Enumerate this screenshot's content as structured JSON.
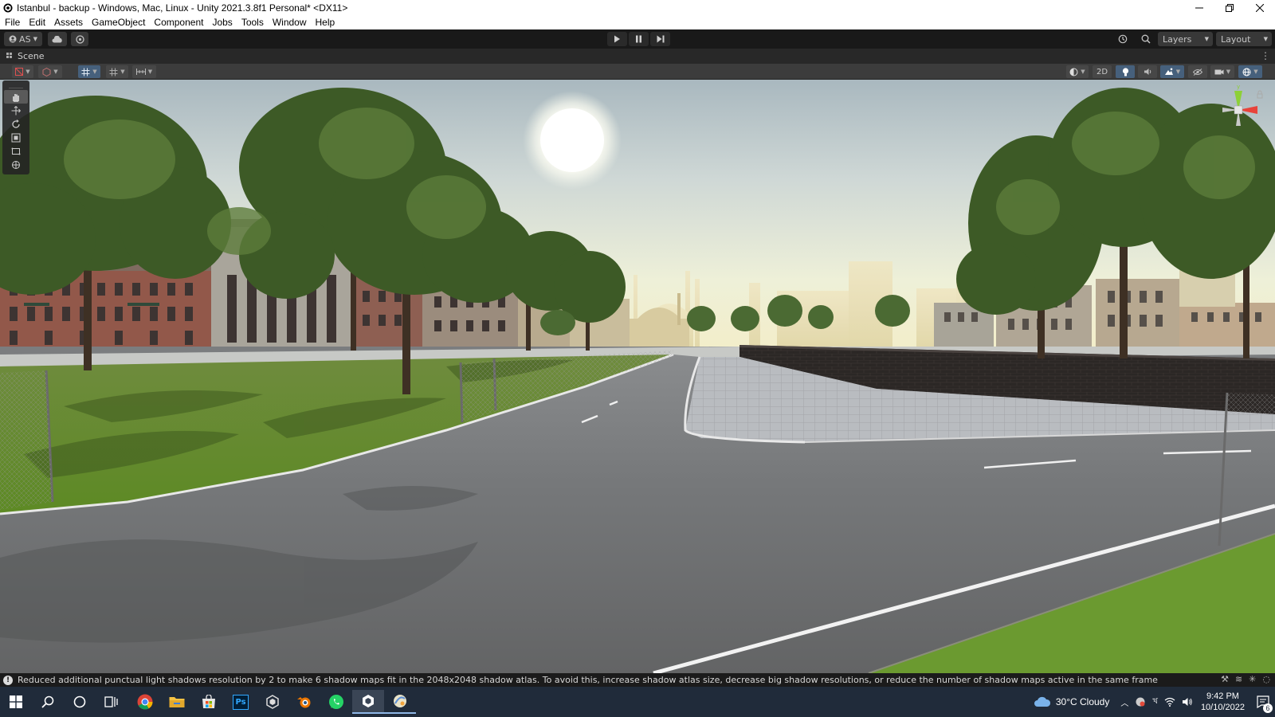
{
  "window": {
    "title": "Istanbul - backup - Windows, Mac, Linux - Unity 2021.3.8f1 Personal* <DX11>",
    "controls": [
      "minimize",
      "restore",
      "close"
    ]
  },
  "menu": [
    "File",
    "Edit",
    "Assets",
    "GameObject",
    "Component",
    "Jobs",
    "Tools",
    "Window",
    "Help"
  ],
  "toolbar": {
    "account_label": "AS",
    "layers_label": "Layers",
    "layout_label": "Layout",
    "playmode_icons": [
      "play-icon",
      "pause-icon",
      "step-icon"
    ]
  },
  "scene": {
    "tab_label": "Scene",
    "toggle_2d_label": "2D",
    "tools": [
      "hand-tool-icon",
      "move-tool-icon",
      "rotate-tool-icon",
      "scale-tool-icon",
      "rect-tool-icon",
      "transform-tool-icon"
    ],
    "gizmo_axes": {
      "y": "#8dd036",
      "x": "#e8433a",
      "z": "#4a7fe0"
    }
  },
  "status": {
    "message": "Reduced additional punctual light shadows resolution by 2 to make 6 shadow maps fit in the 2048x2048 shadow atlas. To avoid this, increase shadow atlas size, decrease big shadow resolutions, or reduce the number of shadow maps active in the same frame"
  },
  "taskbar": {
    "apps": [
      "windows-start-icon",
      "search-icon",
      "cortana-icon",
      "task-view-icon",
      "chrome-icon",
      "file-explorer-icon",
      "microsoft-store-icon",
      "photoshop-icon",
      "unity-hub-icon",
      "blender-icon",
      "whatsapp-icon",
      "unity-editor-icon",
      "other-app-icon"
    ],
    "photoshop_label": "Ps",
    "weather": "30°C  Cloudy",
    "time": "9:42 PM",
    "date": "10/10/2022",
    "notification_count": "6"
  },
  "colors": {
    "toolbar_bg": "#191919",
    "scene_toolbar_bg": "#3c3c3c",
    "active_blue": "#46607c",
    "taskbar_bg": "#202b3a"
  }
}
